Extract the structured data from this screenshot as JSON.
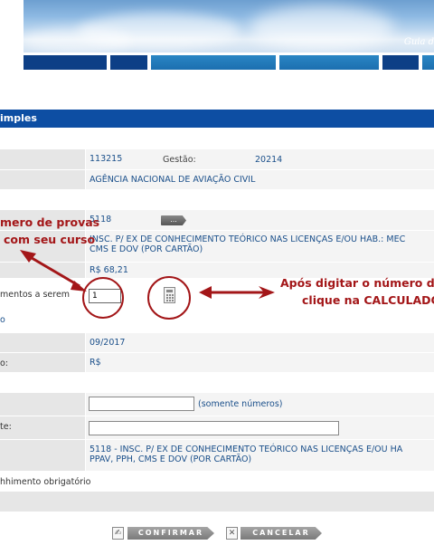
{
  "header": {
    "banner_caption": "Guia d",
    "title": "imples"
  },
  "form": {
    "rows": {
      "ug_value": "113215",
      "gestao_label": "Gestão:",
      "gestao_value": "20214",
      "orgao_value": "AGÊNCIA NACIONAL DE AVIAÇÃO CIVIL",
      "codigo_value": "5118",
      "codigo_button": "...",
      "descricao_value_1": "INSC. P/ EX DE CONHECIMENTO TEÓRICO NAS LICENÇAS E/OU HAB.: MEC",
      "descricao_value_2": "CMS E DOV (POR CARTÃO)",
      "valor_value": "R$ 68,21",
      "quantidade_label": "mentos a serem",
      "quantidade_value": "1",
      "link_label": "o",
      "competencia_value": "09/2017",
      "total_label": "o:",
      "total_value": "R$",
      "cpf_hint": "(somente números)",
      "contribuinte_label": "te:",
      "servico_value_1": "5118  -  INSC. P/ EX DE CONHECIMENTO TEÓRICO NAS LICENÇAS E/OU HA",
      "servico_value_2": "PPAV, PPH, CMS E DOV (POR CARTÃO)",
      "obrigatorio_label": "hhimento obrigatório"
    }
  },
  "annotations": {
    "left_line1": "mero de provas",
    "left_line2": "com seu curso",
    "right_line1": "Após digitar o número de p",
    "right_line2": "clique na CALCULADOR"
  },
  "buttons": {
    "confirm_label": "CONFIRMAR",
    "cancel_label": "CANCELAR"
  },
  "colors": {
    "accent": "#0d4ea3",
    "annotation": "#a31618",
    "link": "#1a4f8a"
  }
}
